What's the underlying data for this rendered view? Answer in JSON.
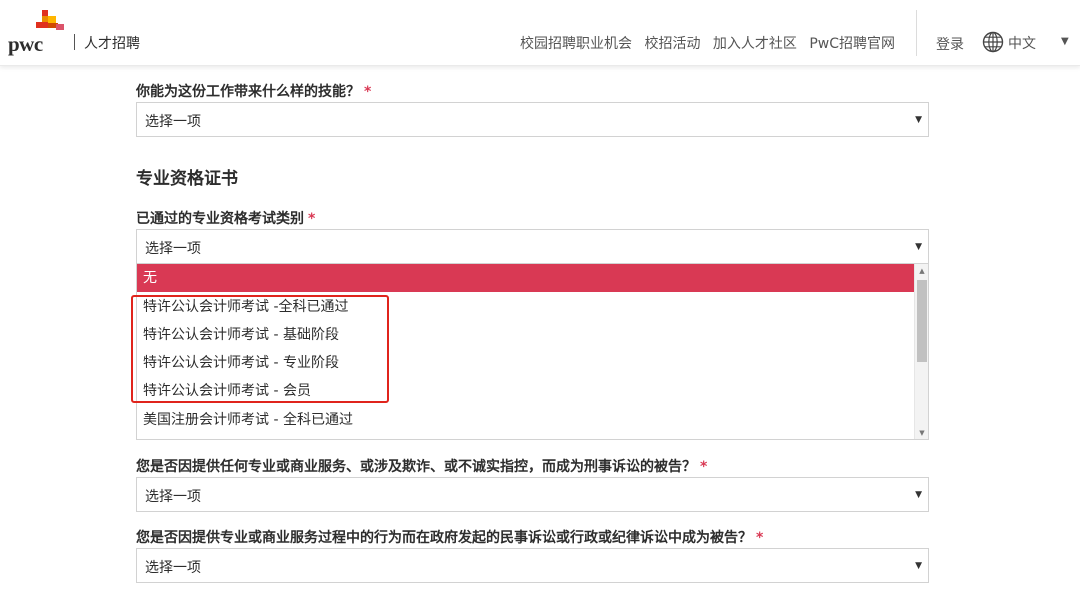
{
  "header": {
    "logo_text": "pwc",
    "brand_sub": "人才招聘",
    "nav_items": [
      "校园招聘职业机会",
      "校招活动",
      "加入人才社区",
      "PwC招聘官网"
    ],
    "login": "登录",
    "language": "中文",
    "icons": {
      "globe": "globe-icon",
      "lang_caret": "caret-down-icon"
    },
    "logo_colors": [
      "#e0301e",
      "#eb8c00",
      "#ffb600",
      "#d04a02",
      "#db536a"
    ]
  },
  "form": {
    "q1": {
      "label": "你能为这份工作带来什么样的技能？",
      "required": "*",
      "value": "选择一项"
    },
    "section_title": "专业资格证书",
    "q2": {
      "label": "已通过的专业资格考试类别",
      "required": "*",
      "value": "选择一项",
      "options": [
        "无",
        "特许公认会计师考试 -全科已通过",
        "特许公认会计师考试 - 基础阶段",
        "特许公认会计师考试 - 专业阶段",
        "特许公认会计师考试 - 会员",
        "美国注册会计师考试 - 全科已通过"
      ],
      "highlighted_index": 0
    },
    "q3": {
      "label": "您是否因提供任何专业或商业服务、或涉及欺诈、或不诚实指控，而成为刑事诉讼的被告？",
      "required": "*",
      "value": "选择一项"
    },
    "q4": {
      "label": "您是否因提供专业或商业服务过程中的行为而在政府发起的民事诉讼或行政或纪律诉讼中成为被告？",
      "required": "*",
      "value": "选择一项"
    }
  },
  "colors": {
    "accent": "#d93954",
    "annotation": "#e0241c"
  }
}
